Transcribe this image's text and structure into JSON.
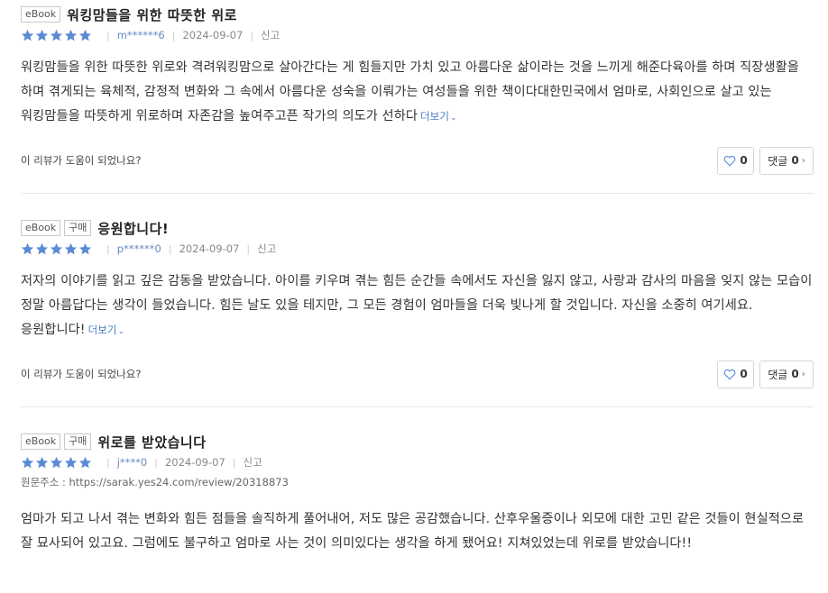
{
  "colors": {
    "star": "#5b8ad6",
    "user": "#6a8ac2",
    "more_link": "#4a79c4",
    "heart": "#5b8ad6"
  },
  "labels": {
    "more": "더보기",
    "helpful_question": "이 리뷰가 도움이 되었나요?",
    "comment": "댓글",
    "report": "신고"
  },
  "reviews": [
    {
      "tags": [
        "eBook"
      ],
      "title": "워킹맘들을 위한 따뜻한 위로",
      "rating": 5,
      "user": "m******6",
      "date": "2024-09-07",
      "report": "신고",
      "body": "워킹맘들을 위한 따뜻한 위로와 격려워킹맘으로 살아간다는 게 힘들지만 가치 있고 아름다운 삶이라는 것을 느끼게 해준다육아를 하며 직장생활을 하며 겪게되는 육체적, 감정적 변화와 그 속에서 아름다운 성숙을 이뤄가는 여성들을 위한 책이다대한민국에서 엄마로, 사회인으로 살고 있는 워킹맘들을 따뜻하게 위로하며 자존감을 높여주고픈 작가의 의도가 선하다",
      "more": "더보기",
      "helpful_question": "이 리뷰가 도움이 되었나요?",
      "likes": "0",
      "comment_label": "댓글",
      "comments": "0"
    },
    {
      "tags": [
        "eBook",
        "구매"
      ],
      "title": "응원합니다!",
      "rating": 5,
      "user": "p******0",
      "date": "2024-09-07",
      "report": "신고",
      "body": "저자의 이야기를 읽고 깊은 감동을 받았습니다. 아이를 키우며 겪는 힘든 순간들 속에서도 자신을 잃지 않고, 사랑과 감사의 마음을 잊지 않는 모습이 정말 아름답다는 생각이 들었습니다. 힘든 날도 있을 테지만, 그 모든 경험이 엄마들을 더욱 빛나게 할 것입니다. 자신을 소중히 여기세요. 응원합니다!",
      "more": "더보기",
      "helpful_question": "이 리뷰가 도움이 되었나요?",
      "likes": "0",
      "comment_label": "댓글",
      "comments": "0"
    },
    {
      "tags": [
        "eBook",
        "구매"
      ],
      "title": "위로를 받았습니다",
      "rating": 5,
      "user": "j****0",
      "date": "2024-09-07",
      "report": "신고",
      "source": "원문주소 : https://sarak.yes24.com/review/20318873",
      "body": "엄마가 되고 나서 겪는 변화와 힘든 점들을 솔직하게 풀어내어, 저도 많은 공감했습니다. 산후우울증이나 외모에 대한 고민 같은 것들이 현실적으로 잘 묘사되어 있고요. 그럼에도 불구하고 엄마로 사는 것이 의미있다는 생각을 하게 됐어요! 지쳐있었는데 위로를 받았습니다!!"
    }
  ]
}
